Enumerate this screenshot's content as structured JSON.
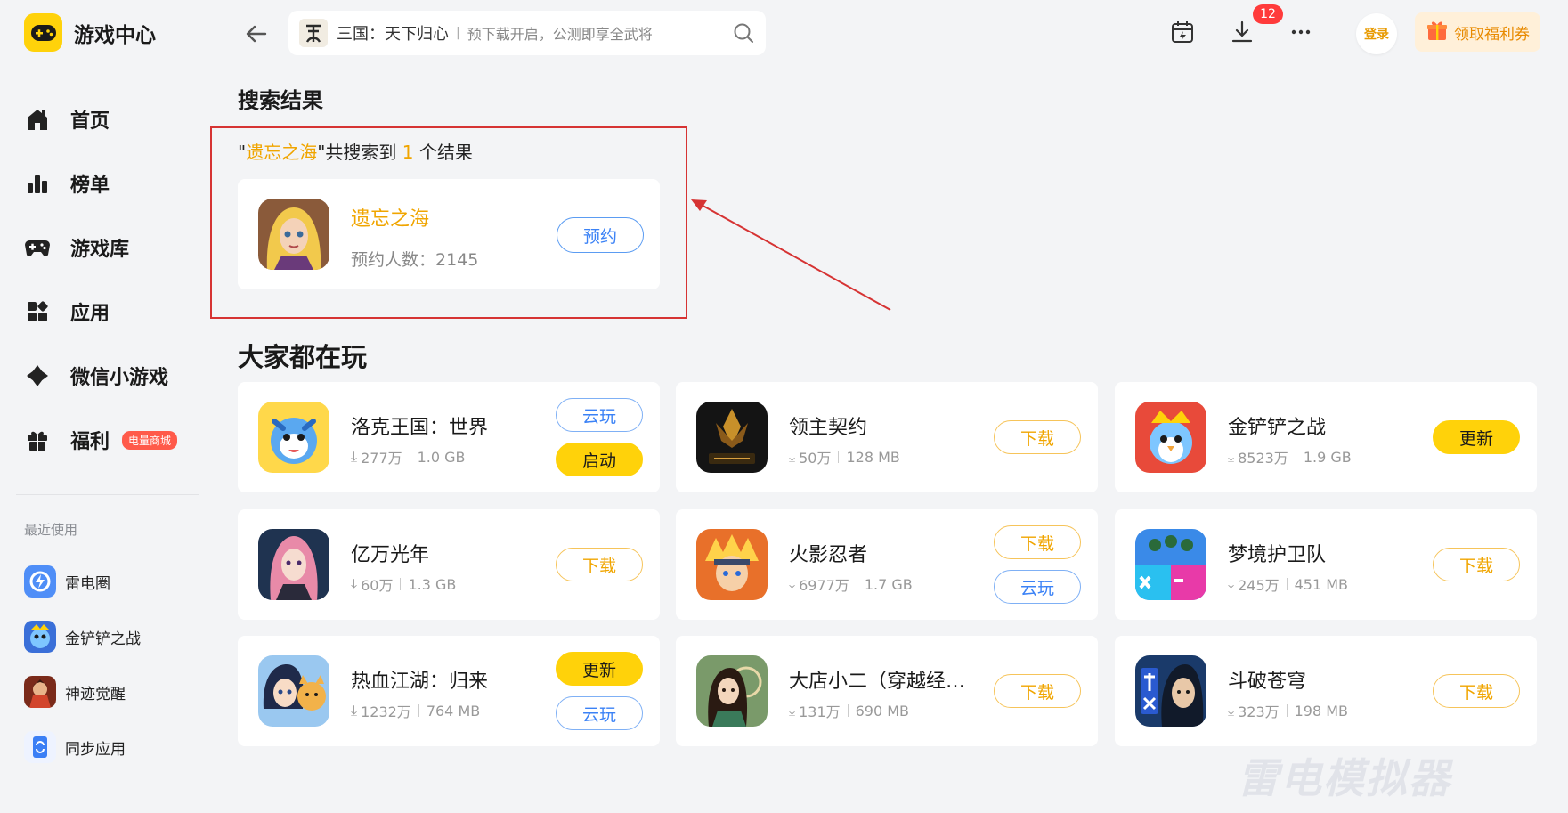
{
  "app": {
    "title": "游戏中心"
  },
  "nav": {
    "items": [
      {
        "label": "首页",
        "icon": "home-icon"
      },
      {
        "label": "榜单",
        "icon": "ranking-icon"
      },
      {
        "label": "游戏库",
        "icon": "gamepad-icon"
      },
      {
        "label": "应用",
        "icon": "apps-icon"
      },
      {
        "label": "微信小游戏",
        "icon": "wechat-game-icon"
      },
      {
        "label": "福利",
        "icon": "gift-icon",
        "badge": "电量商城"
      }
    ]
  },
  "recent": {
    "title": "最近使用",
    "items": [
      {
        "label": "雷电圈"
      },
      {
        "label": "金铲铲之战"
      },
      {
        "label": "神迹觉醒"
      },
      {
        "label": "同步应用"
      }
    ]
  },
  "search": {
    "game": "三国：天下归心",
    "separator": "|",
    "hint": "预下载开启，公测即享全武将"
  },
  "topbar": {
    "download_count": "12",
    "login": "登录",
    "coupon": "领取福利券"
  },
  "results": {
    "title": "搜索结果",
    "summary": {
      "q_open": "\"",
      "keyword": "遗忘之海",
      "q_close": "\"",
      "prefix": "共搜索到 ",
      "count": "1",
      "suffix": " 个结果"
    },
    "item": {
      "name": "遗忘之海",
      "meta": "预约人数：2145",
      "action": "预约"
    }
  },
  "popular": {
    "title": "大家都在玩",
    "games": [
      {
        "name": "洛克王国：世界",
        "downloads": "277万",
        "size": "1.0 GB",
        "buttons": [
          {
            "label": "云玩",
            "style": "blue-outline"
          },
          {
            "label": "启动",
            "style": "yellow"
          }
        ]
      },
      {
        "name": "领主契约",
        "downloads": "50万",
        "size": "128 MB",
        "buttons": [
          {
            "label": "下载",
            "style": "orange-outline"
          }
        ]
      },
      {
        "name": "金铲铲之战",
        "downloads": "8523万",
        "size": "1.9 GB",
        "buttons": [
          {
            "label": "更新",
            "style": "yellow"
          }
        ]
      },
      {
        "name": "亿万光年",
        "downloads": "60万",
        "size": "1.3 GB",
        "buttons": [
          {
            "label": "下载",
            "style": "orange-outline"
          }
        ]
      },
      {
        "name": "火影忍者",
        "downloads": "6977万",
        "size": "1.7 GB",
        "buttons": [
          {
            "label": "下载",
            "style": "orange-outline"
          },
          {
            "label": "云玩",
            "style": "blue-outline"
          }
        ]
      },
      {
        "name": "梦境护卫队",
        "downloads": "245万",
        "size": "451 MB",
        "buttons": [
          {
            "label": "下载",
            "style": "orange-outline"
          }
        ]
      },
      {
        "name": "热血江湖：归来",
        "downloads": "1232万",
        "size": "764 MB",
        "buttons": [
          {
            "label": "更新",
            "style": "yellow"
          },
          {
            "label": "云玩",
            "style": "blue-outline"
          }
        ]
      },
      {
        "name": "大店小二（穿越经…",
        "downloads": "131万",
        "size": "690 MB",
        "buttons": [
          {
            "label": "下载",
            "style": "orange-outline"
          }
        ]
      },
      {
        "name": "斗破苍穹",
        "downloads": "323万",
        "size": "198 MB",
        "buttons": [
          {
            "label": "下载",
            "style": "orange-outline"
          }
        ]
      }
    ]
  },
  "watermark": "雷电模拟器",
  "colors": {
    "brand_yellow": "#ffd20a",
    "accent_orange": "#f0a500",
    "link_blue": "#3b82f6",
    "highlight_red": "#d63333"
  }
}
